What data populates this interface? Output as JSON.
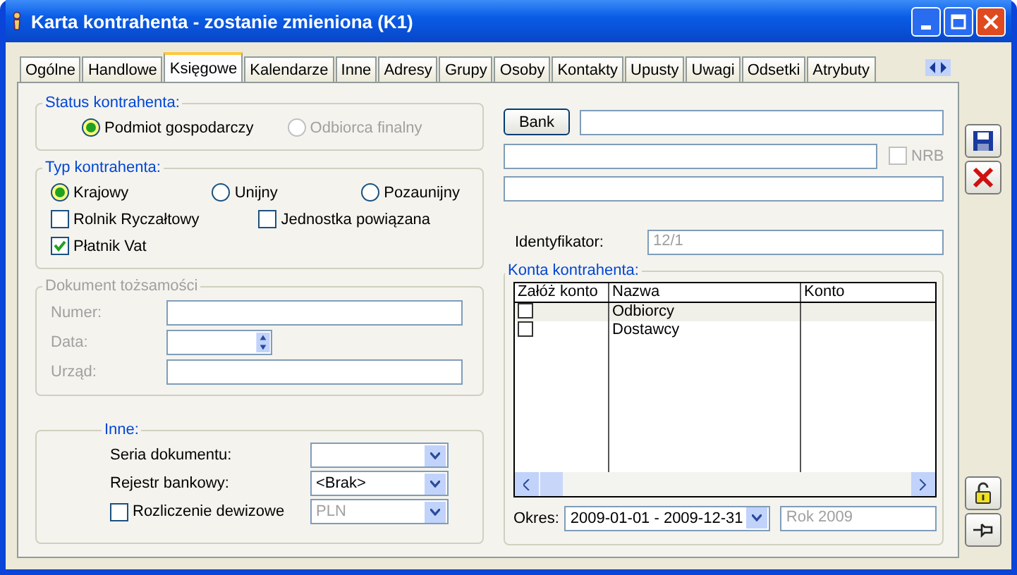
{
  "window": {
    "title": "Karta kontrahenta - zostanie zmieniona (K1)"
  },
  "tabs": [
    {
      "label": "Ogólne",
      "selected": false
    },
    {
      "label": "Handlowe",
      "selected": false
    },
    {
      "label": "Księgowe",
      "selected": true
    },
    {
      "label": "Kalendarze",
      "selected": false
    },
    {
      "label": "Inne",
      "selected": false
    },
    {
      "label": "Adresy",
      "selected": false
    },
    {
      "label": "Grupy",
      "selected": false
    },
    {
      "label": "Osoby",
      "selected": false
    },
    {
      "label": "Kontakty",
      "selected": false
    },
    {
      "label": "Upusty",
      "selected": false
    },
    {
      "label": "Uwagi",
      "selected": false
    },
    {
      "label": "Odsetki",
      "selected": false
    },
    {
      "label": "Atrybuty",
      "selected": false
    }
  ],
  "status_kontrahenta": {
    "label": "Status kontrahenta:",
    "options": [
      {
        "label": "Podmiot gospodarczy",
        "selected": true,
        "disabled": false
      },
      {
        "label": "Odbiorca finalny",
        "selected": false,
        "disabled": true
      }
    ]
  },
  "typ_kontrahenta": {
    "label": "Typ kontrahenta:",
    "options": [
      {
        "label": "Krajowy",
        "selected": true
      },
      {
        "label": "Unijny",
        "selected": false
      },
      {
        "label": "Pozaunijny",
        "selected": false
      }
    ],
    "checkboxes": [
      {
        "label": "Rolnik Ryczałtowy",
        "checked": false
      },
      {
        "label": "Jednostka powiązana",
        "checked": false
      },
      {
        "label": "Płatnik Vat",
        "checked": true
      }
    ]
  },
  "dokument_tozsamosci": {
    "label": "Dokument tożsamości",
    "disabled": true,
    "fields": [
      {
        "label": "Numer:",
        "kind": "text"
      },
      {
        "label": "Data:",
        "kind": "spin"
      },
      {
        "label": "Urząd:",
        "kind": "text"
      }
    ]
  },
  "inne": {
    "label": "Inne:",
    "fields": [
      {
        "kind": "combo",
        "label": "Seria dokumentu:"
      },
      {
        "kind": "combo",
        "label": "Rejestr bankowy:",
        "value": "<Brak>"
      },
      {
        "kind": "check-combo",
        "label": "Rozliczenie dewizowe",
        "checked": false,
        "value": "PLN",
        "disabled": true
      }
    ]
  },
  "bank": {
    "button": "Bank",
    "nrb": {
      "label": "NRB",
      "checked": false,
      "disabled": true
    }
  },
  "identyfikator": {
    "label": "Identyfikator:",
    "value": "12/1",
    "disabled": true
  },
  "konta": {
    "label": "Konta kontrahenta:",
    "columns": [
      "Załóż konto",
      "Nazwa",
      "Konto"
    ],
    "rows": [
      {
        "checked": false,
        "name": "Odbiorcy",
        "selected": true
      },
      {
        "checked": false,
        "name": "Dostawcy",
        "selected": false
      }
    ]
  },
  "okres": {
    "label": "Okres:",
    "value": "2009-01-01 - 2009-12-31",
    "year": "Rok 2009",
    "year_disabled": true
  }
}
